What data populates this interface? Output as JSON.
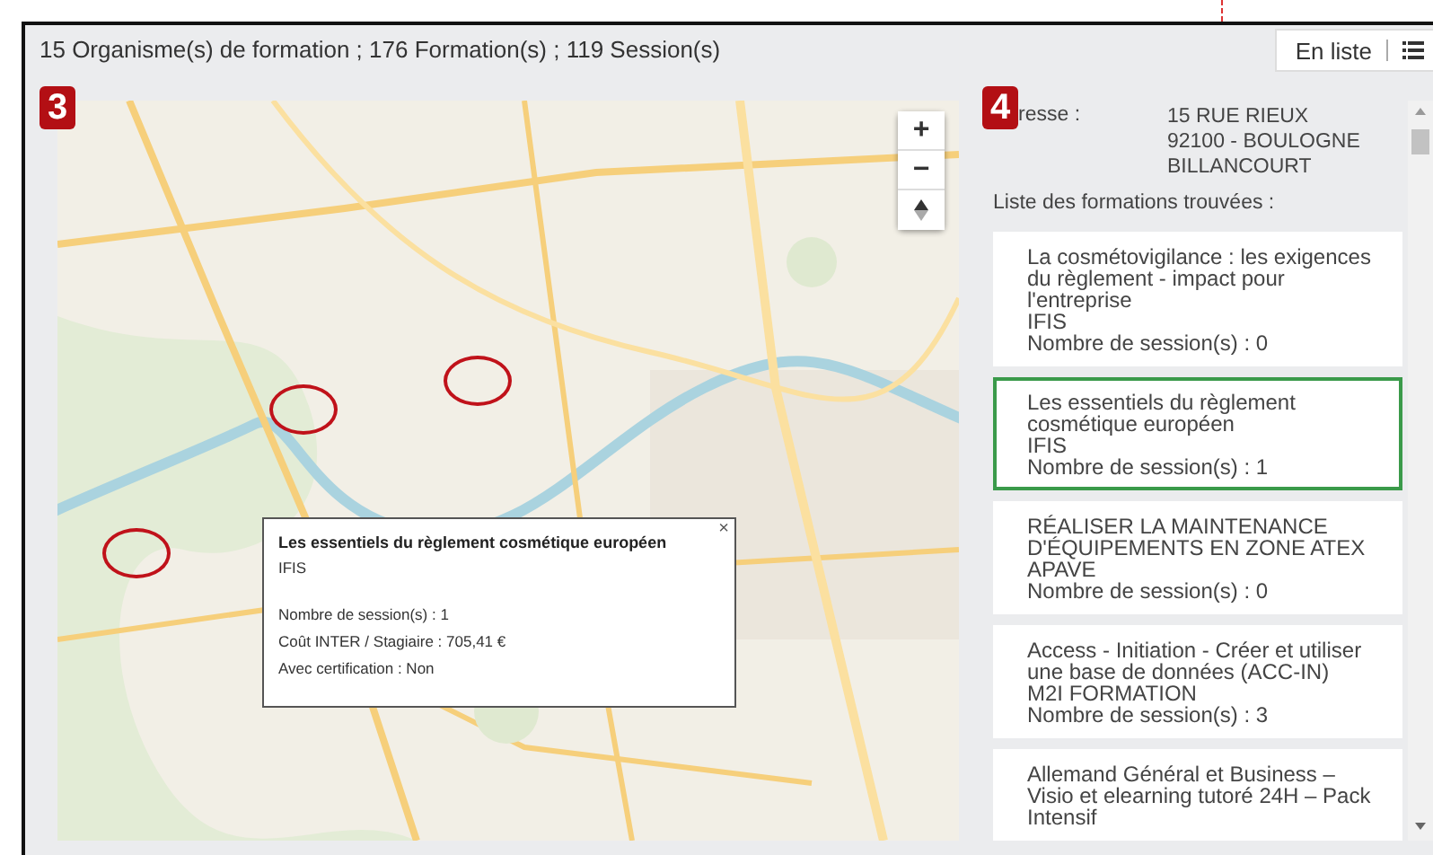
{
  "summary": "15 Organisme(s) de formation ; 176 Formation(s) ; 119 Session(s)",
  "view_toggle": {
    "label": "En liste"
  },
  "map": {
    "badge": "3",
    "zoom_in": "+",
    "zoom_out": "−",
    "markers": [
      {
        "selected": false
      },
      {
        "selected": false
      },
      {
        "selected": false
      }
    ],
    "popup": {
      "title": "Les essentiels du règlement cosmétique européen",
      "provider": "IFIS",
      "lines": [
        "Nombre de session(s) : 1",
        "Coût INTER / Stagiaire : 705,41 €",
        "Avec certification : Non"
      ],
      "close": "×"
    }
  },
  "details": {
    "badge": "4",
    "address_label": "resse :",
    "address_lines": [
      "15 RUE RIEUX",
      "92100 - BOULOGNE",
      "BILLANCOURT"
    ],
    "list_title": "Liste des formations trouvées :",
    "formations": [
      {
        "title": "La cosmétovigilance : les exigences du règlement - impact pour l'entreprise",
        "provider": "IFIS",
        "sessions": "Nombre de session(s) : 0",
        "selected": false
      },
      {
        "title": "Les essentiels du règlement cosmétique européen",
        "provider": "IFIS",
        "sessions": "Nombre de session(s) : 1",
        "selected": true
      },
      {
        "title": "RÉALISER LA MAINTENANCE D'ÉQUIPEMENTS EN ZONE ATEX",
        "provider": "APAVE",
        "sessions": "Nombre de session(s) : 0",
        "selected": false
      },
      {
        "title": "Access - Initiation - Créer et utiliser une base de données (ACC-IN)",
        "provider": "M2I FORMATION",
        "sessions": "Nombre de session(s) : 3",
        "selected": false
      },
      {
        "title": "Allemand Général et Business – Visio et elearning tutoré 24H – Pack Intensif",
        "selected": false
      }
    ]
  }
}
